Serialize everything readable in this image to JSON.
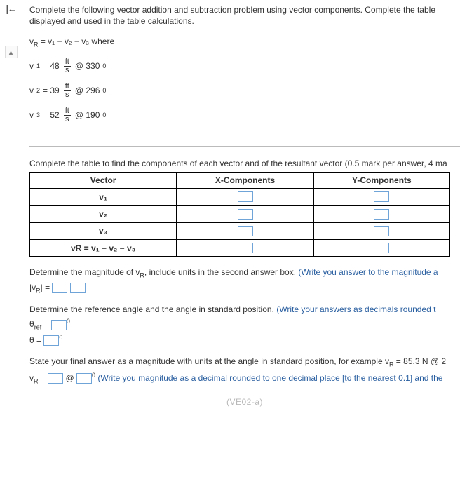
{
  "intro": "Complete the following vector addition and subtraction problem using vector components.  Complete the table displayed and used in the table calculations.",
  "resultant_formula": {
    "lhs": "v",
    "sub_lhs": "R",
    "rest": " = v₁ − v₂ − v₃ where"
  },
  "given": [
    {
      "label": "v",
      "sub": "1",
      "eq": " = 48 ",
      "unit_num": "ft",
      "unit_den": "s",
      "at": " @ 330",
      "deg": "0"
    },
    {
      "label": "v",
      "sub": "2",
      "eq": " = 39 ",
      "unit_num": "ft",
      "unit_den": "s",
      "at": " @ 296",
      "deg": "0"
    },
    {
      "label": "v",
      "sub": "3",
      "eq": " = 52 ",
      "unit_num": "ft",
      "unit_den": "s",
      "at": " @ 190",
      "deg": "0"
    }
  ],
  "table_intro": "Complete the table to find the components of each vector and of the resultant vector (0.5 mark per answer, 4 ma",
  "headers": {
    "c1": "Vector",
    "c2": "X-Components",
    "c3": "Y-Components"
  },
  "rows": {
    "r1": "v₁",
    "r2": "v₂",
    "r3": "v₃",
    "r4": "vR = v₁ − v₂ − v₃"
  },
  "q_mag": {
    "text": "Determine the magnitude of v",
    "sub": "R",
    "text2": ", include units in the second answer box.  ",
    "hint": "(Write you answer to the magnitude a"
  },
  "mag_line": {
    "pre": "|v",
    "sub": "R",
    "post": "| = "
  },
  "q_angle": {
    "text": "Determine the reference angle and the angle in standard position.  ",
    "hint": "(Write your answers as decimals rounded t"
  },
  "theta_ref": {
    "sym": "θ",
    "sub": "ref",
    "eq": " = ",
    "sup": "0"
  },
  "theta": {
    "sym": "θ = ",
    "sup": "0"
  },
  "q_final": {
    "text": "State your final answer as a magnitude with units at the angle in standard position, for example v",
    "sub": "R",
    "example": " = 85.3 N @ 2"
  },
  "final_line": {
    "pre": "v",
    "sub": "R",
    "eq": " = ",
    "at": " @ ",
    "sup": "0",
    "hint": " (Write you magnitude as a decimal rounded to one decimal place [to the nearest 0.1] and the"
  },
  "footer_code": "(VE02-a)"
}
